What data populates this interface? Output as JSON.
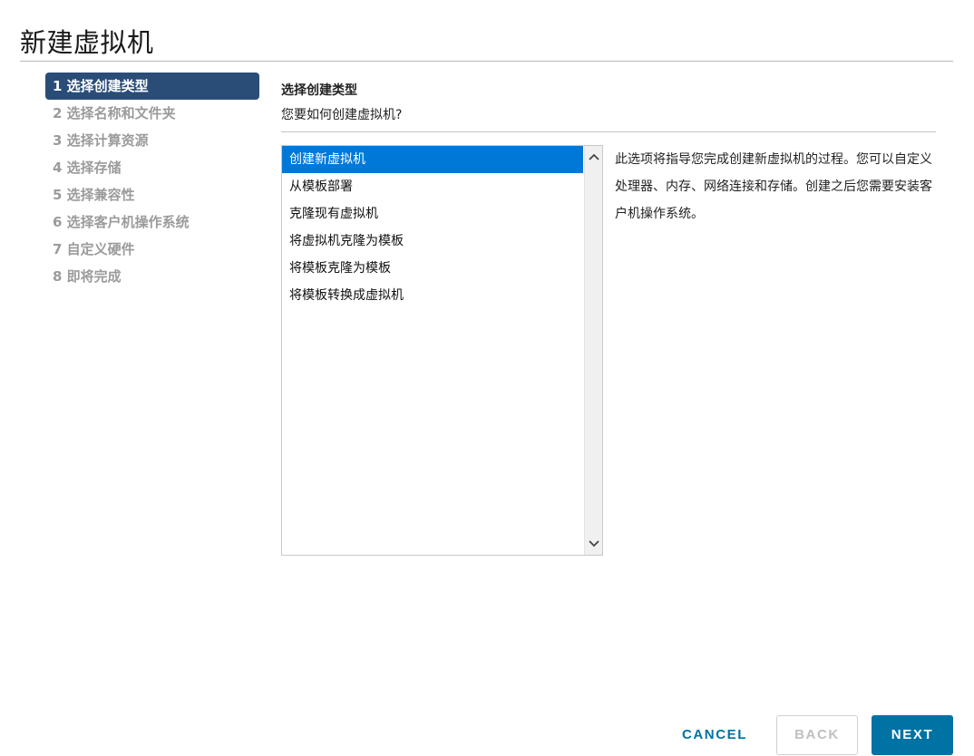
{
  "dialog": {
    "title": "新建虚拟机"
  },
  "steps": [
    {
      "label": "1 选择创建类型",
      "state": "active"
    },
    {
      "label": "2 选择名称和文件夹",
      "state": "disabled"
    },
    {
      "label": "3 选择计算资源",
      "state": "disabled"
    },
    {
      "label": "4 选择存储",
      "state": "disabled"
    },
    {
      "label": "5 选择兼容性",
      "state": "disabled"
    },
    {
      "label": "6 选择客户机操作系统",
      "state": "disabled"
    },
    {
      "label": "7 自定义硬件",
      "state": "disabled"
    },
    {
      "label": "8 即将完成",
      "state": "disabled"
    }
  ],
  "content": {
    "heading": "选择创建类型",
    "question": "您要如何创建虚拟机?",
    "options": [
      {
        "label": "创建新虚拟机",
        "selected": true
      },
      {
        "label": "从模板部署",
        "selected": false
      },
      {
        "label": "克隆现有虚拟机",
        "selected": false
      },
      {
        "label": "将虚拟机克隆为模板",
        "selected": false
      },
      {
        "label": "将模板克隆为模板",
        "selected": false
      },
      {
        "label": "将模板转换成虚拟机",
        "selected": false
      }
    ],
    "description": "此选项将指导您完成创建新虚拟机的过程。您可以自定义处理器、内存、网络连接和存储。创建之后您需要安装客户机操作系统。"
  },
  "footer": {
    "cancel_label": "CANCEL",
    "back_label": "BACK",
    "next_label": "NEXT"
  },
  "colors": {
    "active_step_bg": "#2a4d78",
    "selected_option_bg": "#0078d7",
    "primary_button": "#0072a3",
    "disabled_text": "#9b9b9b"
  },
  "icons": {
    "scroll_up": "chevron-up-icon",
    "scroll_down": "chevron-down-icon"
  }
}
